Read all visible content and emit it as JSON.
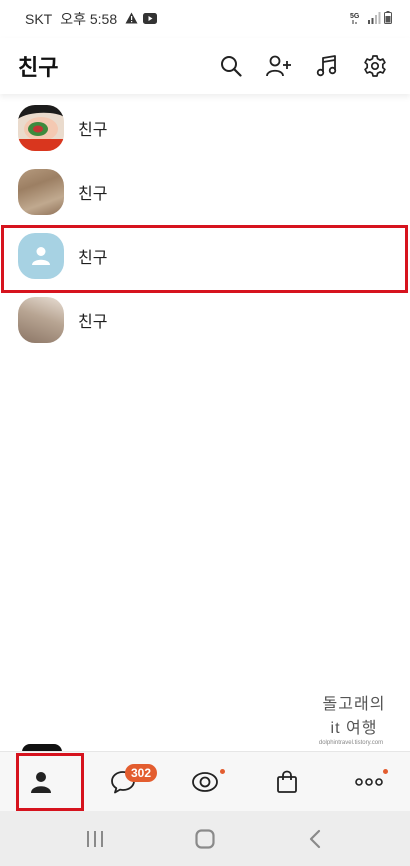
{
  "status_bar": {
    "carrier": "SKT",
    "time": "오후 5:58",
    "icons_left": [
      "warning-icon",
      "youtube-icon"
    ],
    "icons_right": [
      "5g-icon",
      "signal-icon",
      "battery-icon"
    ]
  },
  "header": {
    "title": "친구",
    "actions": [
      "search-icon",
      "add-friend-icon",
      "music-icon",
      "settings-icon"
    ]
  },
  "friends": [
    {
      "name": "친구",
      "avatar": "photo"
    },
    {
      "name": "친구",
      "avatar": "photo"
    },
    {
      "name": "친구",
      "avatar": "default-profile",
      "highlighted": true
    },
    {
      "name": "친구",
      "avatar": "photo"
    }
  ],
  "watermark": {
    "line1": "돌고래의",
    "line2": "it 여행",
    "line3": "dolphintravel.tistory.com"
  },
  "bottom_nav": {
    "items": [
      {
        "name": "friends",
        "icon": "person-icon",
        "selected": true
      },
      {
        "name": "chats",
        "icon": "chat-bubble-icon",
        "badge": "302"
      },
      {
        "name": "view",
        "icon": "eye-icon",
        "dot": true
      },
      {
        "name": "shopping",
        "icon": "shopping-bag-icon"
      },
      {
        "name": "more",
        "icon": "more-icon",
        "dot": true
      }
    ]
  },
  "system_nav": [
    "recent-apps-icon",
    "home-icon",
    "back-icon"
  ],
  "colors": {
    "highlight": "#d6131e",
    "badge": "#e35d2f",
    "default_avatar": "#a7d2e3"
  }
}
